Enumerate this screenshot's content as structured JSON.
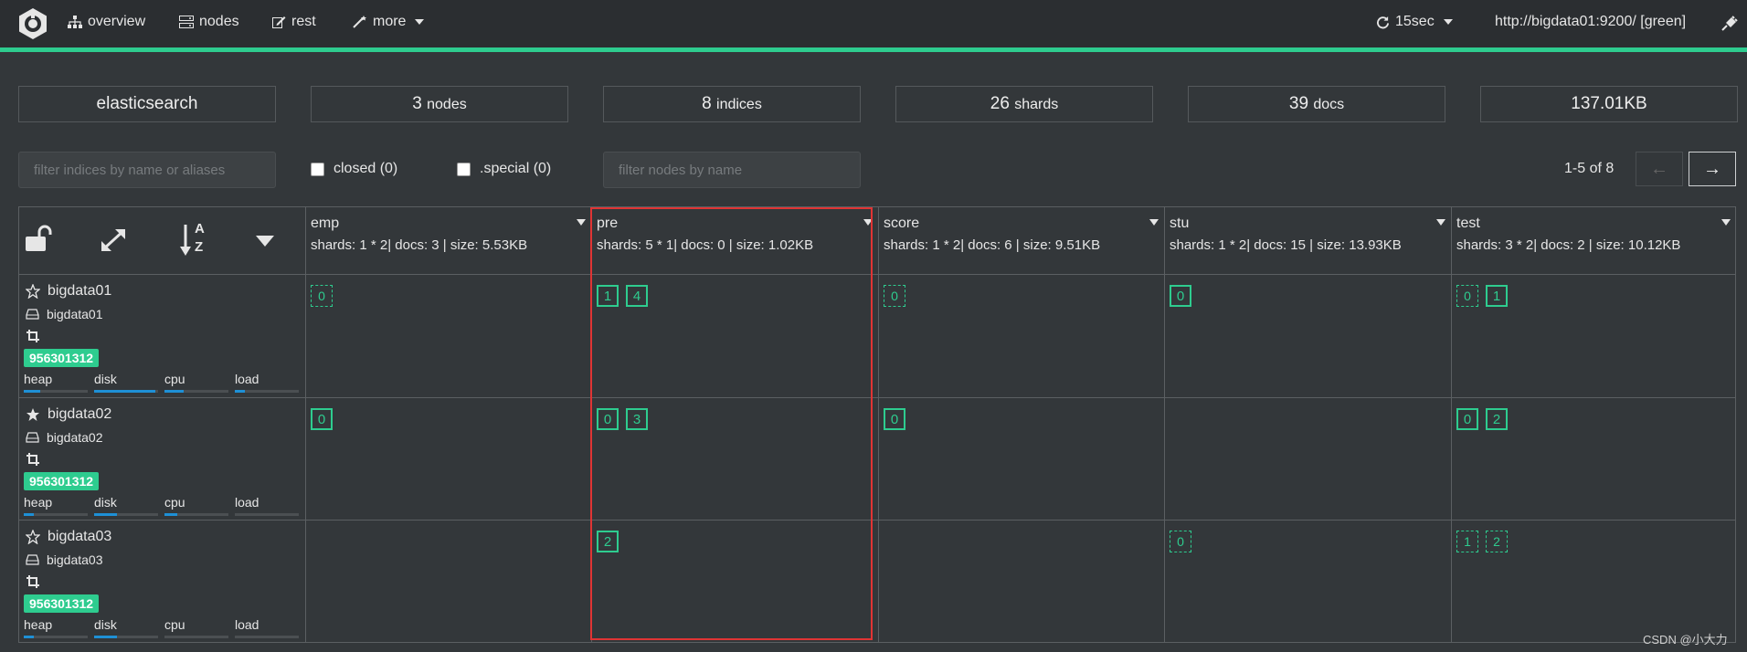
{
  "nav": {
    "overview": "overview",
    "nodes": "nodes",
    "rest": "rest",
    "more": "more",
    "refresh": "15sec",
    "cluster_url": "http://bigdata01:9200/ [green]"
  },
  "stats": {
    "cluster_name": "elasticsearch",
    "nodes_count": "3",
    "nodes_unit": "nodes",
    "indices_count": "8",
    "indices_unit": "indices",
    "shards_count": "26",
    "shards_unit": "shards",
    "docs_count": "39",
    "docs_unit": "docs",
    "size": "137.01KB"
  },
  "filters": {
    "indices_placeholder": "filter indices by name or aliases",
    "closed_label": "closed (0)",
    "special_label": ".special (0)",
    "nodes_placeholder": "filter nodes by name",
    "pager_text": "1-5 of 8",
    "prev_label": "←",
    "next_label": "→"
  },
  "toolbar": {
    "sort_a": "A",
    "sort_z": "Z"
  },
  "indices": [
    {
      "name": "emp",
      "meta": "shards: 1 * 2| docs: 3 | size: 5.53KB"
    },
    {
      "name": "pre",
      "meta": "shards: 5 * 1| docs: 0 | size: 1.02KB"
    },
    {
      "name": "score",
      "meta": "shards: 1 * 2| docs: 6 | size: 9.51KB"
    },
    {
      "name": "stu",
      "meta": "shards: 1 * 2| docs: 15 | size: 13.93KB"
    },
    {
      "name": "test",
      "meta": "shards: 3 * 2| docs: 2 | size: 10.12KB"
    }
  ],
  "nodes": [
    {
      "name": "bigdata01",
      "host": "bigdata01",
      "id": "956301312",
      "master": false,
      "heap": 0.25,
      "disk": 0.95,
      "cpu": 0.3,
      "load": 0.15
    },
    {
      "name": "bigdata02",
      "host": "bigdata02",
      "id": "956301312",
      "master": true,
      "heap": 0.15,
      "disk": 0.35,
      "cpu": 0.2,
      "load": 0
    },
    {
      "name": "bigdata03",
      "host": "bigdata03",
      "id": "956301312",
      "master": false,
      "heap": 0.15,
      "disk": 0.35,
      "cpu": 0,
      "load": 0
    }
  ],
  "metric_labels": {
    "heap": "heap",
    "disk": "disk",
    "cpu": "cpu",
    "load": "load"
  },
  "shards": [
    [
      [
        {
          "n": "0",
          "t": "replica"
        }
      ],
      [
        {
          "n": "1",
          "t": "primary"
        },
        {
          "n": "4",
          "t": "primary"
        }
      ],
      [
        {
          "n": "0",
          "t": "replica"
        }
      ],
      [
        {
          "n": "0",
          "t": "primary"
        }
      ],
      [
        {
          "n": "0",
          "t": "replica"
        },
        {
          "n": "1",
          "t": "primary"
        }
      ]
    ],
    [
      [
        {
          "n": "0",
          "t": "primary"
        }
      ],
      [
        {
          "n": "0",
          "t": "primary"
        },
        {
          "n": "3",
          "t": "primary"
        }
      ],
      [
        {
          "n": "0",
          "t": "primary"
        }
      ],
      [],
      [
        {
          "n": "0",
          "t": "primary"
        },
        {
          "n": "2",
          "t": "primary"
        }
      ]
    ],
    [
      [],
      [
        {
          "n": "2",
          "t": "primary"
        }
      ],
      [],
      [
        {
          "n": "0",
          "t": "replica"
        }
      ],
      [
        {
          "n": "1",
          "t": "replica"
        },
        {
          "n": "2",
          "t": "replica"
        }
      ]
    ]
  ],
  "watermark": "CSDN @小大力",
  "colors": {
    "accent": "#2ecc8f",
    "highlight": "#e03434",
    "bar": "#1e90d6"
  }
}
